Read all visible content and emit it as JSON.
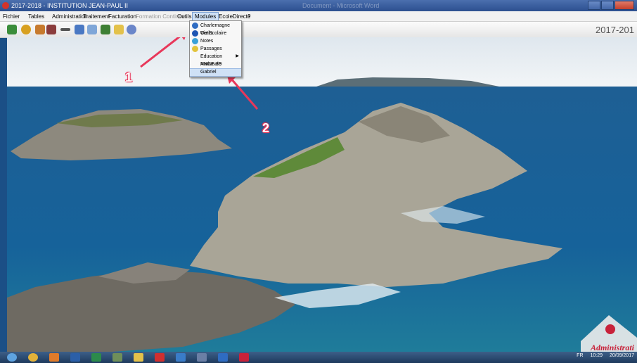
{
  "titlebar": {
    "title": "2017-2018 - INSTITUTION JEAN-PAUL II",
    "faded_text": "Document - Microsoft Word"
  },
  "menubar": {
    "items": [
      "Fichier",
      "Tables",
      "Administration",
      "Traitement",
      "Facturation",
      "Formation Continue",
      "Outils",
      "Modules",
      "EcoleDirecte",
      "?"
    ]
  },
  "toolbar": {
    "year": "2017-201"
  },
  "dropdown": {
    "items": [
      "Charlemagne Outils",
      "Vie Scolaire",
      "Notes",
      "Passages",
      "Education Nationale",
      "ANGE 3D",
      "Gabriel"
    ]
  },
  "annotations": {
    "one": "1",
    "two": "2"
  },
  "logo": {
    "text": "Administrati"
  },
  "taskbar": {
    "lang": "FR",
    "time": "10:29",
    "date": "20/09/2017"
  },
  "colors": {
    "accent": "#e8375a",
    "menu_highlight": "#cfe1f6",
    "brand_red": "#c8223a"
  }
}
